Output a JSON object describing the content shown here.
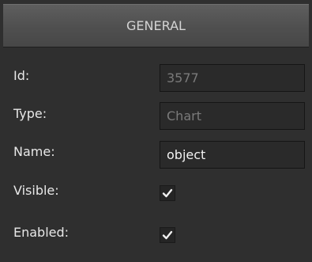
{
  "header": {
    "title": "GENERAL"
  },
  "fields": {
    "id": {
      "label": "Id:",
      "value": "3577"
    },
    "type": {
      "label": "Type:",
      "value": "Chart"
    },
    "name": {
      "label": "Name:",
      "value": "object"
    },
    "visible": {
      "label": "Visible:",
      "checked": true
    },
    "enabled": {
      "label": "Enabled:",
      "checked": true
    }
  },
  "icons": {
    "checkmark": "check-icon"
  },
  "colors": {
    "panel_bg": "#2f2f2f",
    "header_bg": "#525252",
    "field_bg": "#2a2a2a",
    "text": "#e8e8e8",
    "readonly_text": "#7a7a7a"
  }
}
